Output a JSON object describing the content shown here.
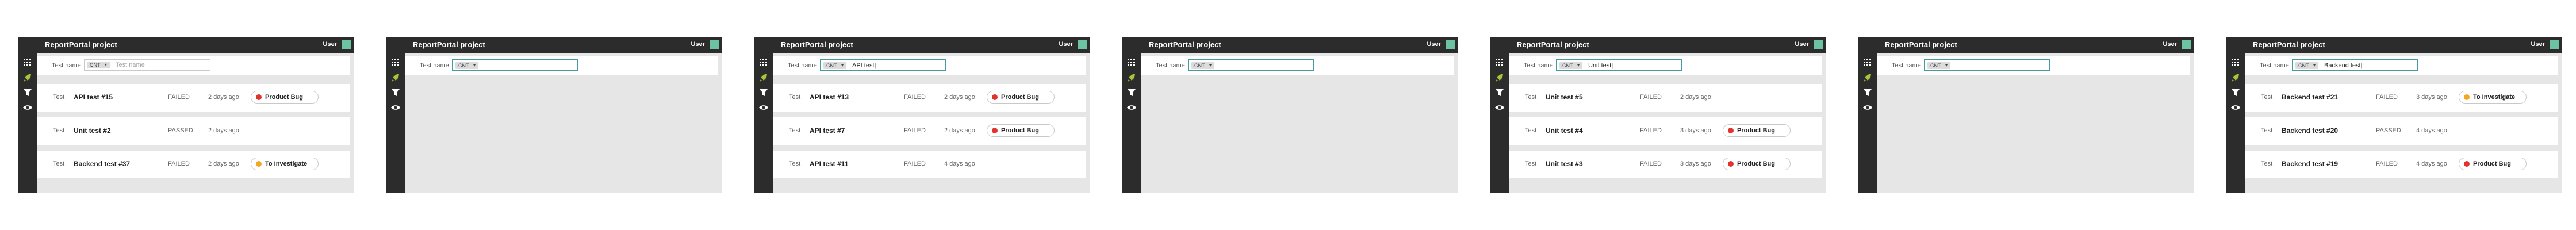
{
  "app": {
    "project": "ReportPortal project",
    "user": "User"
  },
  "colors": {
    "product_bug": "#e2342f",
    "to_investigate": "#f5a623",
    "accent": "#4a9a9b"
  },
  "filter": {
    "label": "Test name",
    "condition": "CNT",
    "placeholder": "Test name"
  },
  "states": [
    {
      "filter_value": "",
      "placeholder_shown": true,
      "rows": [
        {
          "type": "Test",
          "name": "API test #15",
          "status": "FAILED",
          "time": "2 days ago",
          "defect": "Product Bug"
        },
        {
          "type": "Test",
          "name": "Unit test #2",
          "status": "PASSED",
          "time": "2 days ago",
          "defect": ""
        },
        {
          "type": "Test",
          "name": "Backend test #37",
          "status": "FAILED",
          "time": "2 days ago",
          "defect": "To Investigate"
        }
      ]
    },
    {
      "filter_value": "|",
      "placeholder_shown": false,
      "rows": []
    },
    {
      "filter_value": "API test|",
      "placeholder_shown": false,
      "rows": [
        {
          "type": "Test",
          "name": "API test #13",
          "status": "FAILED",
          "time": "2 days ago",
          "defect": "Product Bug"
        },
        {
          "type": "Test",
          "name": "API test #7",
          "status": "FAILED",
          "time": "2 days ago",
          "defect": "Product Bug"
        },
        {
          "type": "Test",
          "name": "API test #11",
          "status": "FAILED",
          "time": "4 days ago",
          "defect": ""
        }
      ]
    },
    {
      "filter_value": "|",
      "placeholder_shown": false,
      "rows": []
    },
    {
      "filter_value": "Unit test|",
      "placeholder_shown": false,
      "rows": [
        {
          "type": "Test",
          "name": "Unit test #5",
          "status": "FAILED",
          "time": "2 days ago",
          "defect": ""
        },
        {
          "type": "Test",
          "name": "Unit test #4",
          "status": "FAILED",
          "time": "3 days ago",
          "defect": "Product Bug"
        },
        {
          "type": "Test",
          "name": "Unit test #3",
          "status": "FAILED",
          "time": "3 days ago",
          "defect": "Product Bug"
        }
      ]
    },
    {
      "filter_value": "|",
      "placeholder_shown": false,
      "rows": []
    },
    {
      "filter_value": "Backend test|",
      "placeholder_shown": false,
      "rows": [
        {
          "type": "Test",
          "name": "Backend test #21",
          "status": "FAILED",
          "time": "3 days ago",
          "defect": "To Investigate"
        },
        {
          "type": "Test",
          "name": "Backend test #20",
          "status": "PASSED",
          "time": "4 days ago",
          "defect": ""
        },
        {
          "type": "Test",
          "name": "Backend test #19",
          "status": "FAILED",
          "time": "4 days ago",
          "defect": "Product Bug"
        }
      ]
    }
  ]
}
